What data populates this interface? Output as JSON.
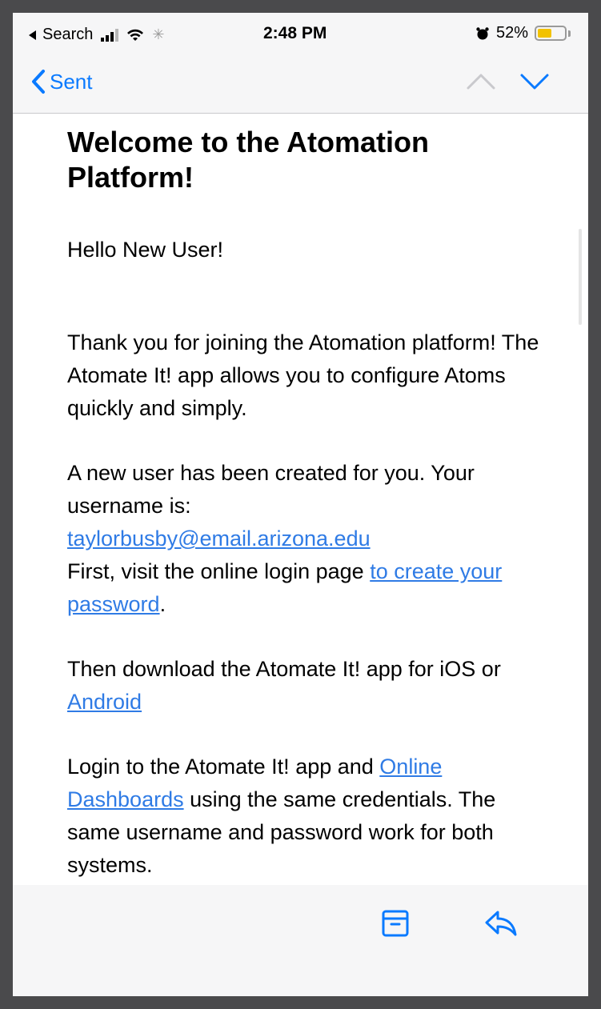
{
  "status_bar": {
    "back_app": "Search",
    "time": "2:48 PM",
    "battery_percent": "52%",
    "battery_level": 0.52
  },
  "nav": {
    "back_label": "Sent"
  },
  "email": {
    "title": "Welcome to the Atomation Platform!",
    "greeting": "Hello New User!",
    "para1": "Thank you for joining the Atomation platform! The Atomate It! app allows you to configure Atoms quickly and simply.",
    "para2_text": "A new user has been created for you. Your username is:",
    "username_link": "taylorbusby@email.arizona.edu",
    "para2_line2_prefix": "First, visit the online login page ",
    "create_password_link": "to create your password",
    "para2_suffix": ".",
    "para3_prefix": "Then download the Atomate It! app for iOS or ",
    "android_link": "Android",
    "para4_prefix": "Login to the Atomate It! app and ",
    "dashboards_link": "Online Dashboards",
    "para4_suffix": " using the same credentials. The same username and password work for both systems."
  },
  "colors": {
    "accent": "#0a7aff",
    "link": "#2f7be5",
    "battery": "#f2c200"
  },
  "icons": {
    "archive": "archive-icon",
    "reply": "reply-icon",
    "up": "chevron-up-icon",
    "down": "chevron-down-icon"
  }
}
